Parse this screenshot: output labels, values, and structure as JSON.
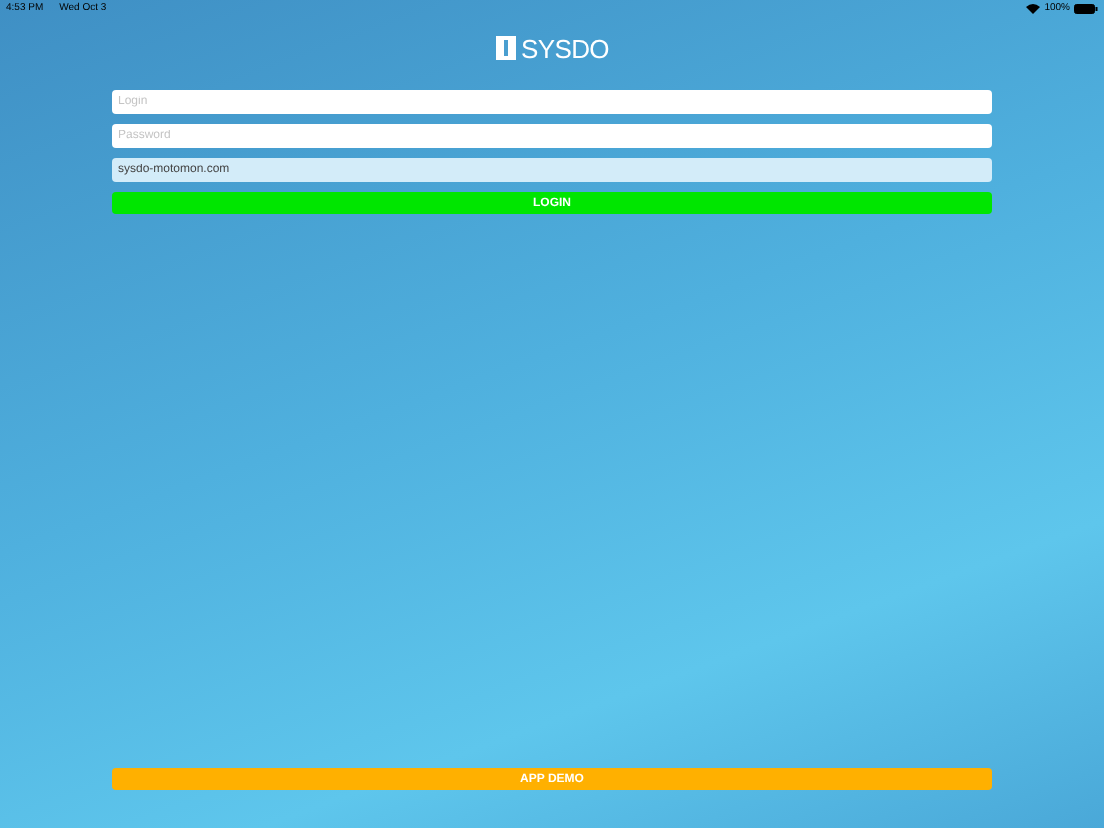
{
  "status_bar": {
    "time": "4:53 PM",
    "date": "Wed Oct 3",
    "battery": "100%"
  },
  "logo": {
    "text": "SYSDO"
  },
  "fields": [
    {
      "placeholder": "Login",
      "disabled": false
    },
    {
      "placeholder": "Password",
      "disabled": false
    },
    {
      "value": "sysdo-motomon.com",
      "disabled": true
    }
  ],
  "login_button": "LOGIN",
  "demo_button": "APP DEMO"
}
